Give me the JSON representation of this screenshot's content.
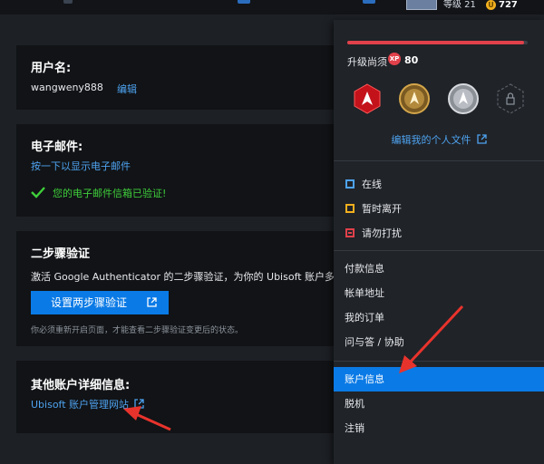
{
  "topbar": {
    "level_label": "等级 21",
    "coins": "727",
    "coin_icon": "coin-icon",
    "avatar_icon": "avatar-icon"
  },
  "account": {
    "username_title": "用户名:",
    "username": "wangweny888",
    "edit_label": "编辑",
    "email_title": "电子邮件:",
    "email_reveal": "按一下以显示电子邮件",
    "email_verified": "您的电子邮件信箱已验证!",
    "twofa_title": "二步骤验证",
    "twofa_desc": "激活 Google Authenticator 的二步骤验证，为你的 Ubisoft 账户多加一",
    "twofa_button": "设置两步骤验证",
    "twofa_note": "你必须重新开启页面，才能查看二步骤验证变更后的状态。",
    "other_title": "其他账户详细信息:",
    "other_link": "Ubisoft 账户管理网站"
  },
  "dropdown": {
    "xp_progress": 0.98,
    "xp_label": "升级尚须",
    "xp_badge": "XP",
    "xp_value": "80",
    "profile_link": "编辑我的个人文件",
    "badge_icons": [
      "assassin-red-badge-icon",
      "assassin-gold-badge-icon",
      "assassin-silver-badge-icon",
      "locked-badge-icon"
    ],
    "statuses": [
      {
        "label": "在线",
        "color": "#4ea3f0"
      },
      {
        "label": "暂时离开",
        "color": "#f2b01e"
      },
      {
        "label": "请勿打扰",
        "color": "#e1414b"
      }
    ],
    "menu": [
      "付款信息",
      "帐单地址",
      "我的订单",
      "问与答 / 协助",
      "账户信息",
      "脱机",
      "注销"
    ],
    "active_menu": "账户信息"
  },
  "colors": {
    "accent": "#0a7ae6",
    "link": "#4ea3f0",
    "success": "#3fcf3a",
    "xp_red": "#e1414b",
    "arrow_red": "#e8332c"
  }
}
